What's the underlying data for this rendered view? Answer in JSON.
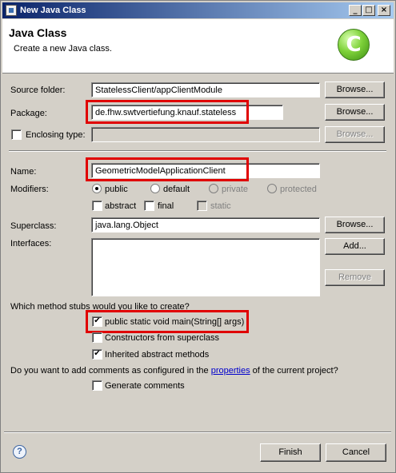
{
  "window": {
    "title": "New Java Class",
    "minimize_glyph": "_",
    "maximize_glyph": "□",
    "close_glyph": "×"
  },
  "header": {
    "title": "Java Class",
    "description": "Create a new Java class.",
    "logo_glyph": "C",
    "logo_color": "#5cb82a"
  },
  "form": {
    "source_folder": {
      "label": "Source folder:",
      "value": "StatelessClient/appClientModule",
      "button": "Browse..."
    },
    "package": {
      "label": "Package:",
      "value": "de.fhw.swtvertiefung.knauf.stateless",
      "button": "Browse..."
    },
    "enclosing_type": {
      "label": "Enclosing type:",
      "value": "",
      "checked": false,
      "button": "Browse..."
    },
    "name": {
      "label": "Name:",
      "value": "GeometricModelApplicationClient"
    },
    "modifiers": {
      "label": "Modifiers:",
      "public": "public",
      "default": "default",
      "private": "private",
      "protected": "protected",
      "abstract": "abstract",
      "final": "final",
      "static": "static",
      "selected": "public"
    },
    "superclass": {
      "label": "Superclass:",
      "value": "java.lang.Object",
      "button": "Browse..."
    },
    "interfaces": {
      "label": "Interfaces:",
      "add_button": "Add...",
      "remove_button": "Remove"
    },
    "stubs": {
      "question": "Which method stubs would you like to create?",
      "main": {
        "label": "public static void main(String[] args)",
        "checked": true
      },
      "constructors": {
        "label": "Constructors from superclass",
        "checked": false
      },
      "inherited": {
        "label": "Inherited abstract methods",
        "checked": true
      }
    },
    "comments": {
      "question_prefix": "Do you want to add comments as configured in the ",
      "question_link": "properties",
      "question_suffix": " of the current project?",
      "generate": {
        "label": "Generate comments",
        "checked": false
      }
    }
  },
  "footer": {
    "help_glyph": "?",
    "finish": "Finish",
    "cancel": "Cancel"
  },
  "colors": {
    "highlight": "#e00000",
    "titlebar_start": "#0a246a",
    "titlebar_end": "#a6caf0",
    "link": "#0000cc"
  }
}
